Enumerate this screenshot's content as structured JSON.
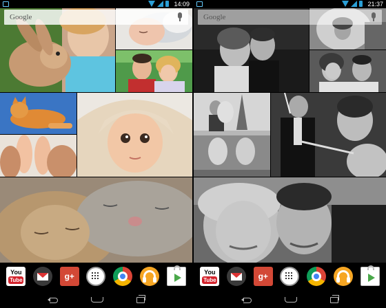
{
  "screens": [
    {
      "id": "left",
      "status": {
        "time": "14:09"
      },
      "search": {
        "label": "Google"
      },
      "wallpaper": {
        "tone": "color",
        "tiles": [
          "bunny-and-child",
          "sleeping-baby",
          "smiling-couple",
          "orange-kitten",
          "baby-feet",
          "baby-in-towel",
          "sleeping-kittens"
        ]
      },
      "dock": [
        "YouTube",
        "Gmail",
        "Google+",
        "Apps",
        "Chrome",
        "Play Music",
        "Play Store"
      ]
    },
    {
      "id": "right",
      "status": {
        "time": "21:37"
      },
      "search": {
        "label": "Google"
      },
      "wallpaper": {
        "tone": "grayscale",
        "tiles": [
          "wedding-couple-car",
          "bride-veil",
          "bride-groom-smiling",
          "eiffel-couple",
          "groom-tie",
          "bride-portrait",
          "wedding-couple-closeup"
        ]
      },
      "dock": [
        "YouTube",
        "Gmail",
        "Google+",
        "Apps",
        "Chrome",
        "Play Music",
        "Play Store"
      ]
    }
  ],
  "youtube_text": {
    "line1": "You",
    "line2": "Tube"
  },
  "gplus_text": "g+",
  "colors": {
    "status_icons": "#2a9fd6",
    "gplus": "#d34836",
    "youtube": "#d3232c",
    "music": "#f6a623",
    "store": "#4aa84a"
  }
}
